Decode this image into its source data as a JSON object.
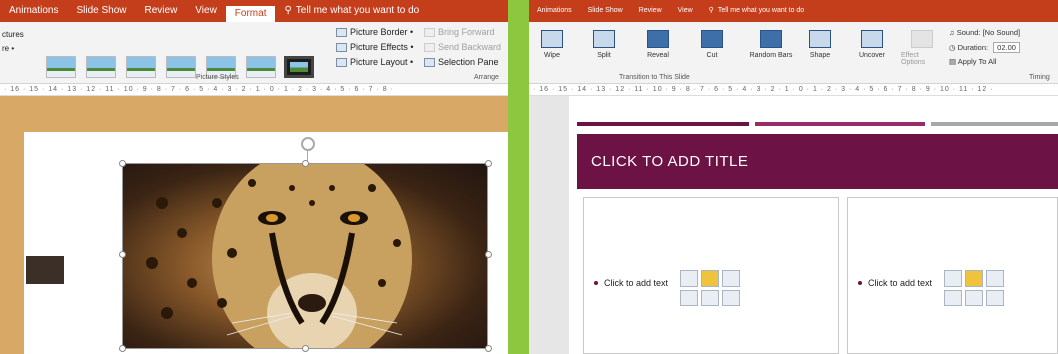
{
  "left": {
    "tabs": [
      "Animations",
      "Slide Show",
      "Review",
      "View",
      "Format",
      "Tell me what you want to do"
    ],
    "active_tab": "Format",
    "ribbon": {
      "partial_left_top": "ctures",
      "partial_left_mid": "re •",
      "picture_border": "Picture Border •",
      "picture_effects": "Picture Effects •",
      "picture_layout": "Picture Layout •",
      "bring_forward": "Bring Forward",
      "send_backward": "Send Backward",
      "selection_pane": "Selection Pane",
      "group_label": "Picture Styles",
      "arrange_label": "Arrange"
    },
    "ruler": "· 16 · 15 · 14 · 13 · 12 · 11 · 10 · 9 · 8 · 7 · 6 · 5 · 4 · 3 · 2 · 1 · 0 · 1 · 2 · 3 · 4 · 5 · 6 · 7 · 8 ·",
    "image_icon": "cheetah-photo"
  },
  "right": {
    "tabs": [
      "Animations",
      "Slide Show",
      "Review",
      "View",
      "Tell me what you want to do"
    ],
    "transitions": [
      "Wipe",
      "Split",
      "Reveal",
      "Cut",
      "Random Bars",
      "Shape",
      "Uncover"
    ],
    "effect_options": "Effect Options",
    "sound": "Sound: [No Sound]",
    "duration_label": "Duration:",
    "duration_value": "02.00",
    "apply_to_all": "Apply To All",
    "group_label": "Transition to This Slide",
    "timing_label": "Timing",
    "ruler": "· 16 · 15 · 14 · 13 · 12 · 11 · 10 · 9 · 8 · 7 · 6 · 5 · 4 · 3 · 2 · 1 · 0 · 1 · 2 · 3 · 4 · 5 · 6 · 7 · 8 · 9 · 10 · 11 · 12 ·",
    "title_placeholder": "CLICK TO ADD TITLE",
    "content_left": "Click to add text",
    "content_right": "Click to add text"
  },
  "colors": {
    "border_green": "#8dc63f",
    "ribbon_red": "#c43e1c",
    "title_maroon": "#6d1244"
  }
}
